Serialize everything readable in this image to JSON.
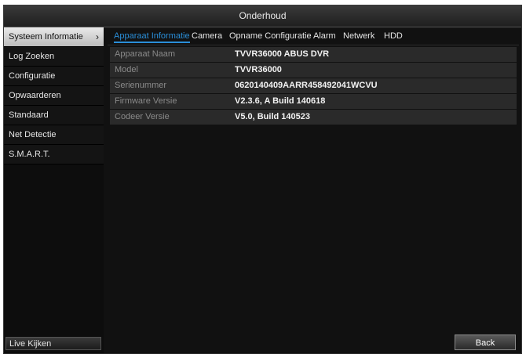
{
  "window": {
    "title": "Onderhoud"
  },
  "sidebar": {
    "items": [
      {
        "label": "Systeem Informatie",
        "active": true
      },
      {
        "label": "Log Zoeken"
      },
      {
        "label": "Configuratie"
      },
      {
        "label": "Opwaarderen"
      },
      {
        "label": "Standaard"
      },
      {
        "label": "Net Detectie"
      },
      {
        "label": "S.M.A.R.T."
      }
    ],
    "chevron": "›",
    "live_label": "Live Kijken"
  },
  "tabs": [
    {
      "label": "Apparaat Informatie",
      "active": true
    },
    {
      "label": "Camera"
    },
    {
      "label": "Opname Configuratie"
    },
    {
      "label": "Alarm"
    },
    {
      "label": "Netwerk"
    },
    {
      "label": "HDD"
    }
  ],
  "info_rows": [
    {
      "label": "Apparaat Naam",
      "value": "TVVR36000 ABUS DVR"
    },
    {
      "label": "Model",
      "value": "TVVR36000"
    },
    {
      "label": "Serienummer",
      "value": "0620140409AARR458492041WCVU"
    },
    {
      "label": "Firmware Versie",
      "value": "V2.3.6, A Build 140618"
    },
    {
      "label": "Codeer Versie",
      "value": "V5.0, Build 140523"
    }
  ],
  "buttons": {
    "back": "Back"
  },
  "colors": {
    "accent": "#2a8ed8",
    "background": "#111111"
  }
}
